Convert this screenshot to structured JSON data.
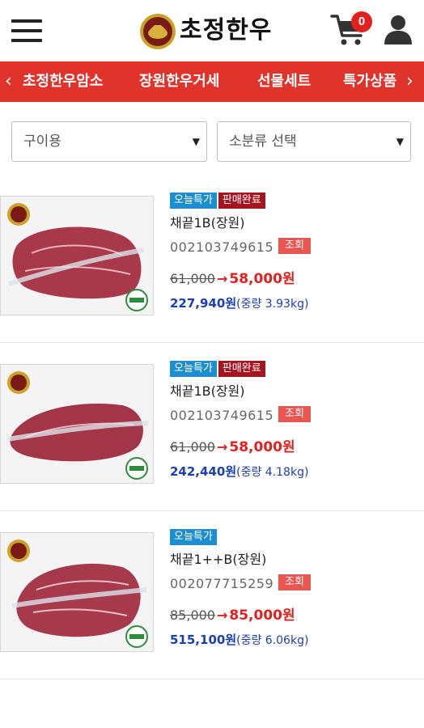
{
  "header": {
    "logo_text": "초정한우",
    "cart_count": "0",
    "icons": [
      "menu-icon",
      "cart-icon",
      "user-icon"
    ]
  },
  "nav": {
    "items": [
      "초정한우암소",
      "장원한우거세",
      "선물세트",
      "특가상품"
    ],
    "prev_arrow": "‹",
    "next_arrow": "›"
  },
  "filters": {
    "category": {
      "selected": "구이용"
    },
    "subcategory": {
      "selected": "소분류 선택"
    }
  },
  "products": [
    {
      "badges": [
        "오늘특가",
        "판매완료"
      ],
      "name": "채끝1B(장원)",
      "code": "002103749615",
      "view_label": "조회",
      "old_price": "61,000",
      "arrow": "→",
      "new_price": "58,000원",
      "total": "227,940원",
      "weight": "(중량 3.93kg)"
    },
    {
      "badges": [
        "오늘특가",
        "판매완료"
      ],
      "name": "채끝1B(장원)",
      "code": "002103749615",
      "view_label": "조회",
      "old_price": "61,000",
      "arrow": "→",
      "new_price": "58,000원",
      "total": "242,440원",
      "weight": "(중량 4.18kg)"
    },
    {
      "badges": [
        "오늘특가"
      ],
      "name": "채끝1++B(장원)",
      "code": "002077715259",
      "view_label": "조회",
      "old_price": "85,000",
      "arrow": "→",
      "new_price": "85,000원",
      "total": "515,100원",
      "weight": "(중량 6.06kg)"
    }
  ],
  "colors": {
    "nav_bg": "#e0332c",
    "badge_today": "#1d8fd0",
    "badge_soldout": "#a31521",
    "view_btn": "#e8574f",
    "price_red": "#e1201f",
    "total_blue": "#1a3fb5"
  }
}
